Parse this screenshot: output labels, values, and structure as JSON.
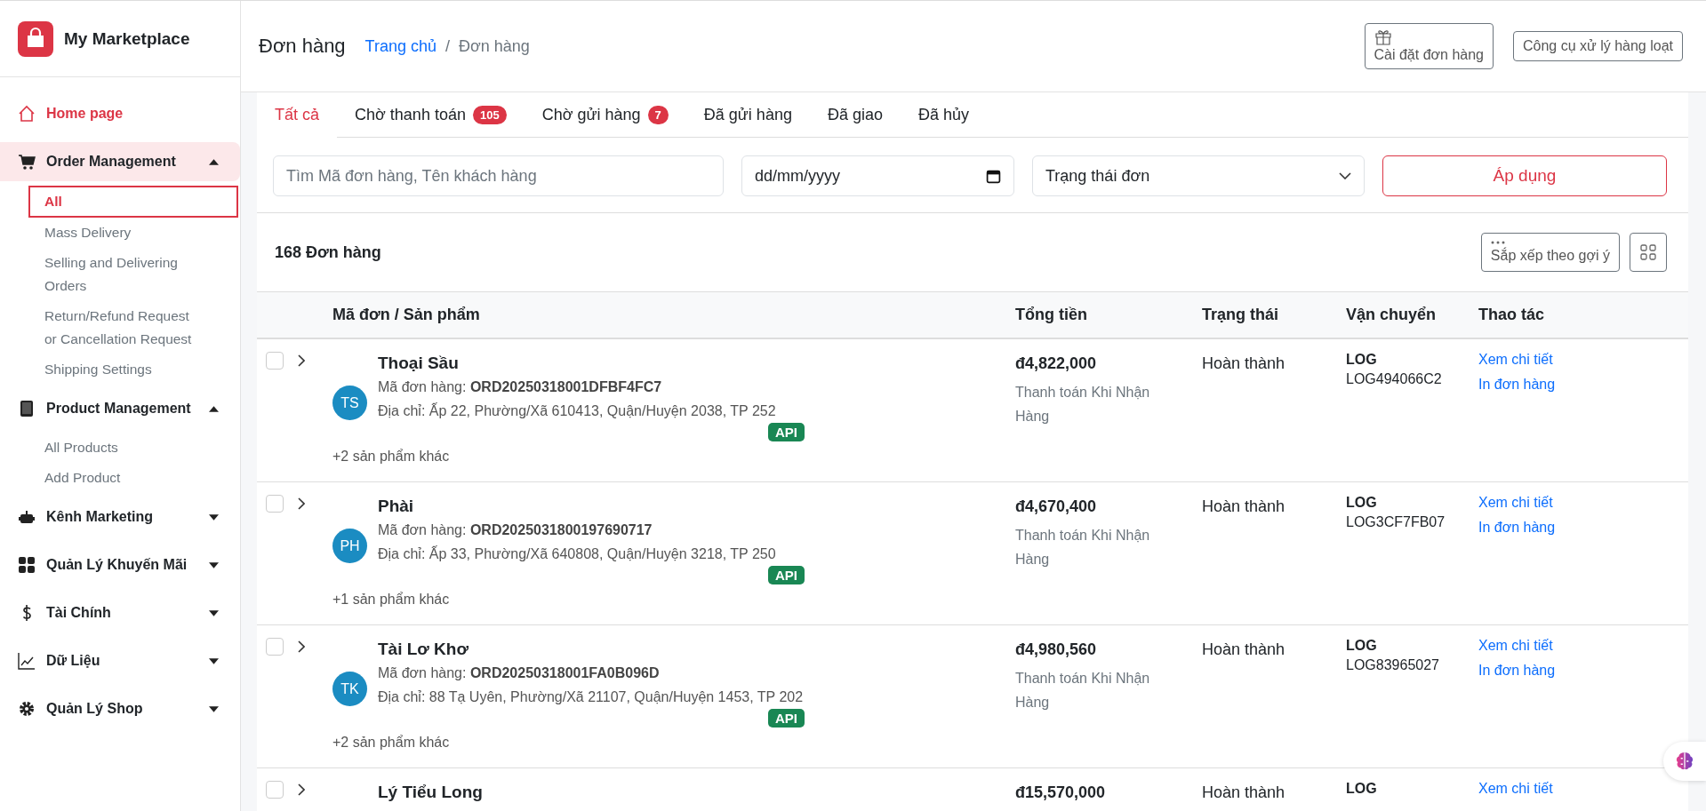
{
  "brand": {
    "name": "My Marketplace"
  },
  "sidebar": {
    "items": [
      {
        "label": "Home page",
        "kind": "link",
        "selected": false
      },
      {
        "label": "Order Management",
        "kind": "group",
        "selected": true,
        "expanded": true,
        "children": [
          {
            "label": "All",
            "selected": true
          },
          {
            "label": "Mass Delivery",
            "selected": false
          },
          {
            "label": "Selling and Delivering Orders",
            "selected": false
          },
          {
            "label": "Return/Refund Request or Cancellation Request",
            "selected": false
          },
          {
            "label": "Shipping Settings",
            "selected": false
          }
        ]
      },
      {
        "label": "Product Management",
        "kind": "group",
        "selected": false,
        "expanded": true,
        "children": [
          {
            "label": "All Products",
            "selected": false
          },
          {
            "label": "Add Product",
            "selected": false
          }
        ]
      },
      {
        "label": "Kênh Marketing",
        "kind": "group",
        "selected": false,
        "expanded": false
      },
      {
        "label": "Quản Lý Khuyến Mãi",
        "kind": "group",
        "selected": false,
        "expanded": false
      },
      {
        "label": "Tài Chính",
        "kind": "group",
        "selected": false,
        "expanded": false
      },
      {
        "label": "Dữ Liệu",
        "kind": "group",
        "selected": false,
        "expanded": false
      },
      {
        "label": "Quản Lý Shop",
        "kind": "group",
        "selected": false,
        "expanded": false
      }
    ]
  },
  "header": {
    "title": "Đơn hàng",
    "breadcrumb_separator": "/",
    "breadcrumb": [
      {
        "label": "Trang chủ",
        "kind": "link"
      },
      {
        "label": "Đơn hàng",
        "kind": "current"
      }
    ],
    "buttons": [
      "Cài đặt đơn hàng",
      "Công cụ xử lý hàng loạt"
    ]
  },
  "tabs": [
    {
      "label": "Tất cả",
      "selected": true
    },
    {
      "label": "Chờ thanh toán",
      "count": "105",
      "selected": false
    },
    {
      "label": "Chờ gửi hàng",
      "count": "7",
      "selected": false
    },
    {
      "label": "Đã gửi hàng",
      "selected": false
    },
    {
      "label": "Đã giao",
      "selected": false
    },
    {
      "label": "Đã hủy",
      "selected": false
    }
  ],
  "filters": {
    "search": {
      "placeholder": "Tìm Mã đơn hàng, Tên khách hàng"
    },
    "date": {
      "value": "dd/mm/yyyy"
    },
    "status": {
      "value": "Trạng thái đơn"
    },
    "apply": "Áp dụng"
  },
  "summary": {
    "count": "168 Đơn hàng",
    "sort": "Sắp xếp theo gợi ý"
  },
  "table": {
    "columns": [
      "Mã đơn / Sản phẩm",
      "Tổng tiền",
      "Trạng thái",
      "Vận chuyển",
      "Thao tác"
    ],
    "rows": [
      {
        "checked": false,
        "name": "Thoại Sầu",
        "initials": "TS",
        "code": "Mã đơn hàng: **ORD20250318001DFBF4FC7**",
        "address": "Địa chỉ: Ấp 22, Phường/Xã 610413, Quận/Huyện 2038, TP 252",
        "source": "API",
        "more": "+2 sản phẩm khác",
        "total": "đ4,822,000",
        "payment": "Thanh toán Khi Nhận Hàng",
        "status": "Hoàn thành",
        "carrier": "LOG",
        "tracking": "LOG494066C2",
        "actions": [
          "Xem chi tiết",
          "In đơn hàng"
        ]
      },
      {
        "checked": false,
        "name": "Phài",
        "initials": "PH",
        "code": "Mã đơn hàng: **ORD2025031800197690717**",
        "address": "Địa chỉ: Ấp 33, Phường/Xã 640808, Quận/Huyện 3218, TP 250",
        "source": "API",
        "more": "+1 sản phẩm khác",
        "total": "đ4,670,400",
        "payment": "Thanh toán Khi Nhận Hàng",
        "status": "Hoàn thành",
        "carrier": "LOG",
        "tracking": "LOG3CF7FB07",
        "actions": [
          "Xem chi tiết",
          "In đơn hàng"
        ]
      },
      {
        "checked": false,
        "name": "Tài Lơ Khơ",
        "initials": "TK",
        "code": "Mã đơn hàng: **ORD20250318001FA0B096D**",
        "address": "Địa chỉ: 88 Tạ Uyên, Phường/Xã 21107, Quận/Huyện 1453, TP 202",
        "source": "API",
        "more": "+2 sản phẩm khác",
        "total": "đ4,980,560",
        "payment": "Thanh toán Khi Nhận Hàng",
        "status": "Hoàn thành",
        "carrier": "LOG",
        "tracking": "LOG83965027",
        "actions": [
          "Xem chi tiết",
          "In đơn hàng"
        ]
      },
      {
        "checked": false,
        "name": "Lý Tiểu Long",
        "total": "đ15,570,000",
        "status": "Hoàn thành",
        "carrier": "LOG",
        "actions": [
          "Xem chi tiết"
        ]
      }
    ]
  }
}
